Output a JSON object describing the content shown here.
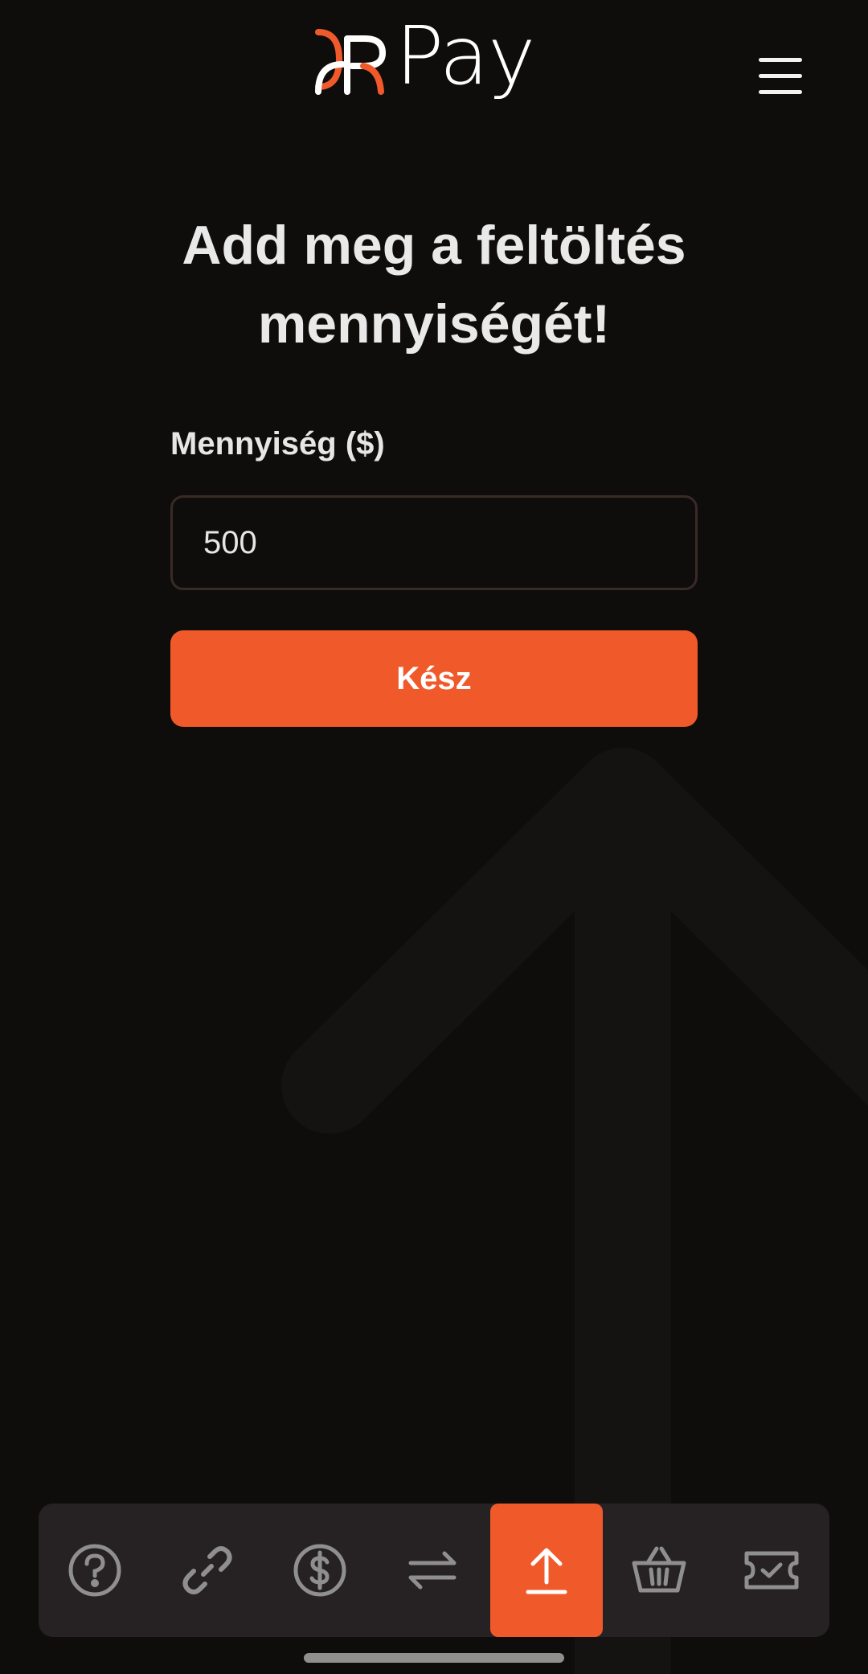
{
  "header": {
    "logo_text": "Pay",
    "menu_icon": "hamburger-menu-icon"
  },
  "main": {
    "title": "Add meg a feltöltés mennyiségét!",
    "amount_label": "Mennyiség ($)",
    "amount_value": "500",
    "done_label": "Kész"
  },
  "bottom_nav": {
    "items": [
      {
        "icon": "help-icon",
        "active": false
      },
      {
        "icon": "link-icon",
        "active": false
      },
      {
        "icon": "dollar-icon",
        "active": false
      },
      {
        "icon": "transfer-icon",
        "active": false
      },
      {
        "icon": "upload-icon",
        "active": true
      },
      {
        "icon": "basket-icon",
        "active": false
      },
      {
        "icon": "ticket-icon",
        "active": false
      }
    ]
  },
  "colors": {
    "background": "#0e0d0c",
    "accent": "#f05a2b",
    "nav_background": "#262224",
    "icon_inactive": "#8f8f8f"
  }
}
